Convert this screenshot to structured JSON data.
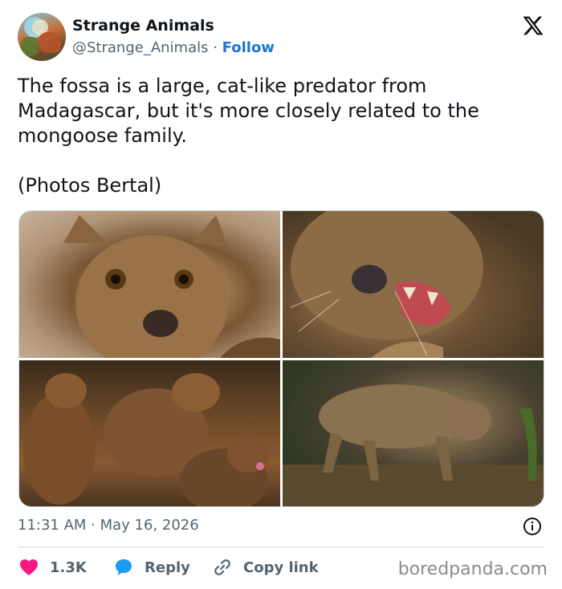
{
  "account": {
    "name": "Strange Animals",
    "handle": "@Strange_Animals",
    "separator": " · ",
    "follow_label": "Follow"
  },
  "tweet": {
    "text": "The fossa is a large, cat-like predator from Madagascar, but it's more closely related to the mongoose family.\n\n(Photos Bertal)",
    "timestamp": "11:31 AM · May 16, 2026"
  },
  "photos": [
    {
      "icon": "photo-fossa-face-closeup"
    },
    {
      "icon": "photo-fossa-yawning"
    },
    {
      "icon": "photo-three-fossas"
    },
    {
      "icon": "photo-fossa-walking"
    }
  ],
  "actions": {
    "like_count": "1.3K",
    "reply_label": "Reply",
    "copy_link_label": "Copy link"
  },
  "watermark": "boredpanda.com",
  "colors": {
    "like": "#f91880",
    "reply": "#1d9bf0",
    "follow": "#1d74d6",
    "muted": "#536471"
  }
}
